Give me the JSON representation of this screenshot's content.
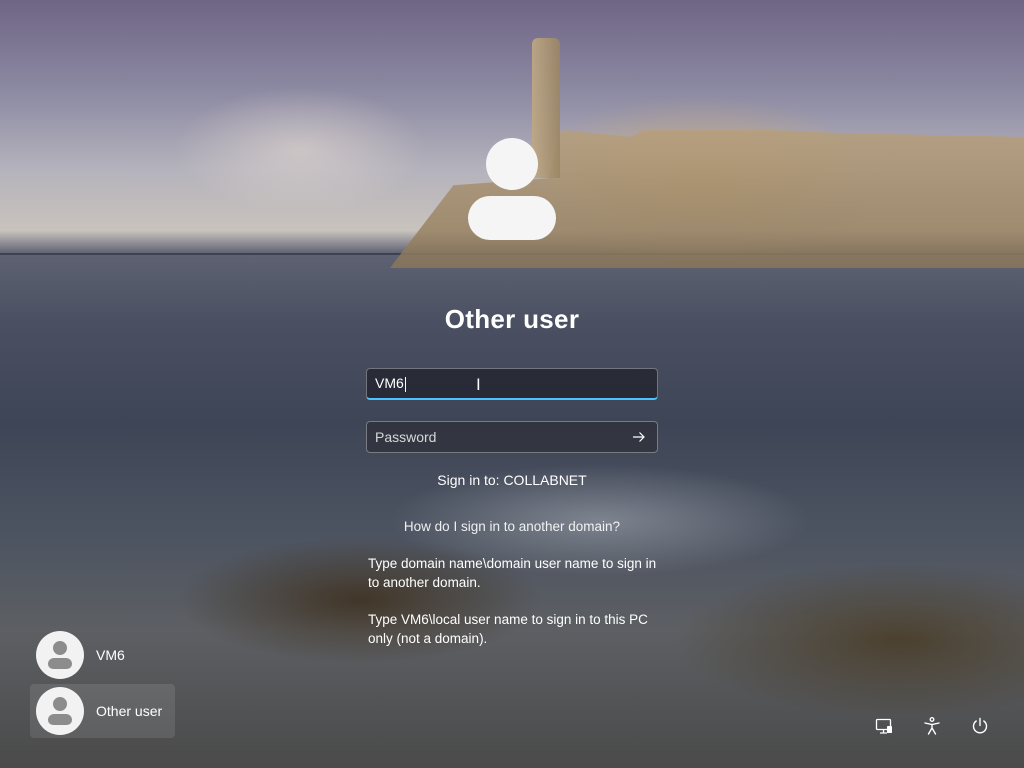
{
  "account": {
    "title": "Other user",
    "username_value": "VM6",
    "password_placeholder": "Password",
    "sign_in_to": "Sign in to: COLLABNET",
    "help_link": "How do I sign in to another domain?",
    "help_p1": "Type domain name\\domain user name to sign in to another domain.",
    "help_p2": "Type VM6\\local user name to sign in to this PC only (not a domain)."
  },
  "users": [
    {
      "name": "VM6"
    },
    {
      "name": "Other user"
    }
  ],
  "icons": {
    "submit": "arrow-right-icon",
    "network": "network-icon",
    "accessibility": "accessibility-icon",
    "power": "power-icon"
  },
  "colors": {
    "focus_accent": "#4cc2ff",
    "avatar_bg": "#f2f2f2",
    "avatar_fg": "#8c8c8c"
  }
}
